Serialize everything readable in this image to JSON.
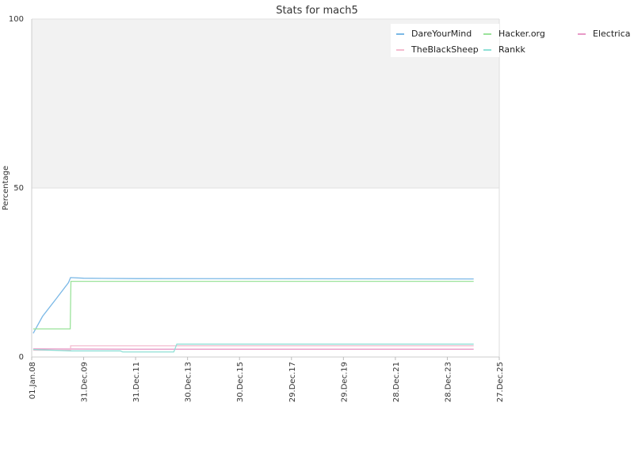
{
  "chart_data": {
    "type": "line",
    "title": "Stats for mach5",
    "xlabel": "",
    "ylabel": "Percentage",
    "ylim": [
      0,
      100
    ],
    "xlim": [
      "2008-01-01",
      "2025-12-27"
    ],
    "y_ticks": [
      "0",
      "50",
      "100"
    ],
    "x_ticks": [
      "01.Jan.08",
      "31.Dec.09",
      "31.Dec.11",
      "30.Dec.13",
      "30.Dec.15",
      "29.Dec.17",
      "29.Dec.19",
      "28.Dec.21",
      "28.Dec.23",
      "27.Dec.25"
    ],
    "x_tick_dates": [
      "2008-01-01",
      "2009-12-31",
      "2011-12-31",
      "2013-12-30",
      "2015-12-30",
      "2017-12-29",
      "2019-12-29",
      "2021-12-28",
      "2023-12-28",
      "2025-12-27"
    ],
    "grid": true,
    "shaded_band": [
      50,
      100
    ],
    "legend_position": "top-right",
    "series": [
      {
        "name": "DareYourMind",
        "color": "#7ab8e6",
        "points": [
          [
            "2008-01-22",
            7
          ],
          [
            "2008-06-01",
            12
          ],
          [
            "2008-12-01",
            17
          ],
          [
            "2009-06-01",
            22
          ],
          [
            "2009-06-30",
            23.5
          ],
          [
            "2010-01-01",
            23.3
          ],
          [
            "2012-01-01",
            23.2
          ],
          [
            "2025-01-01",
            23.1
          ]
        ]
      },
      {
        "name": "Hacker.org",
        "color": "#9be39b",
        "points": [
          [
            "2008-01-22",
            8.3
          ],
          [
            "2009-06-25",
            8.3
          ],
          [
            "2009-07-05",
            22.4
          ],
          [
            "2012-01-01",
            22.4
          ],
          [
            "2025-01-01",
            22.4
          ]
        ]
      },
      {
        "name": "Electrica",
        "color": "#e89ac7",
        "points": [
          [
            "2008-01-22",
            2.4
          ],
          [
            "2012-01-01",
            2.3
          ],
          [
            "2025-01-01",
            2.3
          ]
        ]
      },
      {
        "name": "TheBlackSheep",
        "color": "#f4bccf",
        "points": [
          [
            "2008-01-22",
            2
          ],
          [
            "2009-06-30",
            2
          ],
          [
            "2009-07-01",
            3.3
          ],
          [
            "2013-06-01",
            3.3
          ],
          [
            "2025-01-01",
            3.3
          ]
        ]
      },
      {
        "name": "Rankk",
        "color": "#8fe0d6",
        "points": [
          [
            "2008-01-22",
            2.2
          ],
          [
            "2009-06-30",
            1.8
          ],
          [
            "2011-06-01",
            1.8
          ],
          [
            "2011-07-01",
            1.5
          ],
          [
            "2013-06-20",
            1.5
          ],
          [
            "2013-08-01",
            3.8
          ],
          [
            "2025-01-01",
            3.8
          ]
        ]
      }
    ]
  }
}
